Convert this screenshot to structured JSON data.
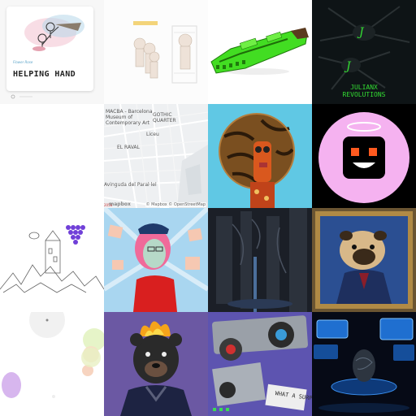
{
  "tiles": [
    {
      "name": "helping-hand-card",
      "small_line": "Flower Rose",
      "title": "HELPING HAND"
    },
    {
      "name": "chibi-sketch-tile"
    },
    {
      "name": "green-vehicle-tile"
    },
    {
      "name": "julianx-revolutions-tile",
      "caption_line1": "JULIANX",
      "caption_line2": "REVOLUTIONS"
    },
    {
      "name": "blank-tile"
    },
    {
      "name": "barcelona-map-tile",
      "labels": {
        "macba": "MACBA - Barcelona\nMuseum of\nContemporary Art",
        "gothic": "GOTHIC\nQUARTER",
        "liceu": "Liceu",
        "raval": "EL RAVAL",
        "paral": "Avinguda del Paral·lel"
      },
      "attribution": "© Mapbox © OpenStreetMap",
      "logo": "mapbox",
      "zoom": "2056"
    },
    {
      "name": "tiger-sphere-character-tile"
    },
    {
      "name": "pink-circle-robot-tile"
    },
    {
      "name": "mountain-castle-sketch-tile"
    },
    {
      "name": "pink-hair-woman-tile"
    },
    {
      "name": "dark-corridor-tile"
    },
    {
      "name": "pug-portrait-tile"
    },
    {
      "name": "pastel-bubbles-tile"
    },
    {
      "name": "flame-bear-tile"
    },
    {
      "name": "what-a-surprise-tile",
      "sign": "WHAT A SURPRISE"
    },
    {
      "name": "monitors-egg-tile"
    }
  ],
  "colors": {
    "accent_green": "#33dd33",
    "map_background": "#eef0f2",
    "pink_circle": "#f5b2f0",
    "bear_background": "#6b58a3"
  }
}
